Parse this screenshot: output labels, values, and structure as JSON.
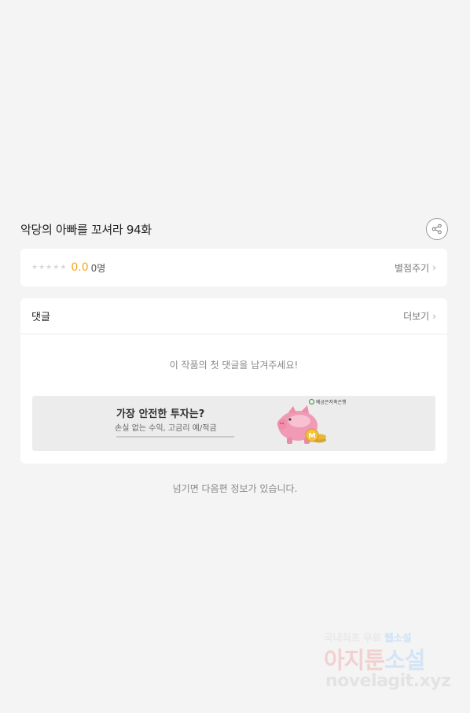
{
  "episode": {
    "title": "악당의 아빠를 꼬셔라 94화"
  },
  "rating": {
    "star_count": 5,
    "score": "0.0",
    "count": "0명",
    "rate_link": "별점주기"
  },
  "comments": {
    "label": "댓글",
    "more_link": "더보기",
    "empty_message": "이 작품의 첫 댓글을 남겨주세요!"
  },
  "ad": {
    "headline": "가장 안전한 투자는?",
    "subline": "손실 없는 수익, 고금리 예/적금",
    "bank": "예금은저축은행"
  },
  "footer": {
    "next_info": "넘기면 다음편 정보가 있습니다."
  },
  "watermark": {
    "line1_a": "국내최초 무료 ",
    "line1_b": "웹소설",
    "main_a": "아지툰",
    "main_b": "소설",
    "url": "novelagit.xyz"
  },
  "colors": {
    "score": "#f5a623",
    "background": "#f4f4f4",
    "card": "#ffffff"
  }
}
